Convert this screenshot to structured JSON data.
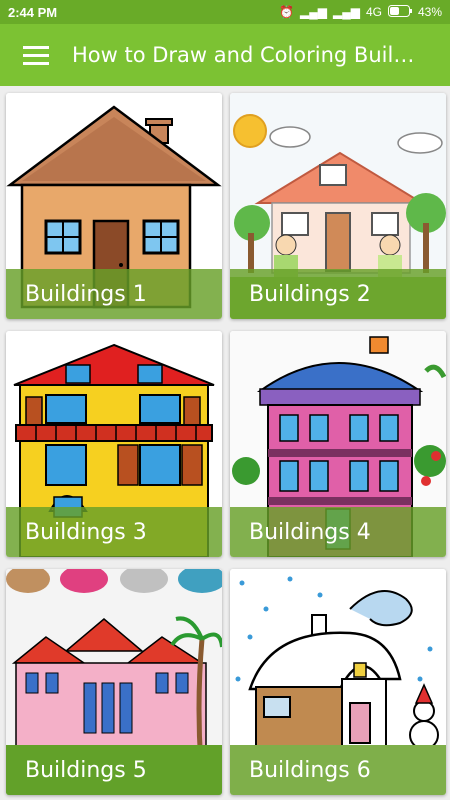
{
  "status_bar": {
    "time": "2:44 PM",
    "network": "4G",
    "battery": "43%"
  },
  "app_bar": {
    "title": "How to Draw and Coloring Buildings"
  },
  "cards": [
    {
      "label": "Buildings 1"
    },
    {
      "label": "Buildings 2"
    },
    {
      "label": "Buildings 3"
    },
    {
      "label": "Buildings 4"
    },
    {
      "label": "Buildings 5"
    },
    {
      "label": "Buildings 6"
    }
  ],
  "colors": {
    "status_bar": "#69ab28",
    "app_bar": "#7cc233",
    "label_overlay": "#68a028"
  }
}
